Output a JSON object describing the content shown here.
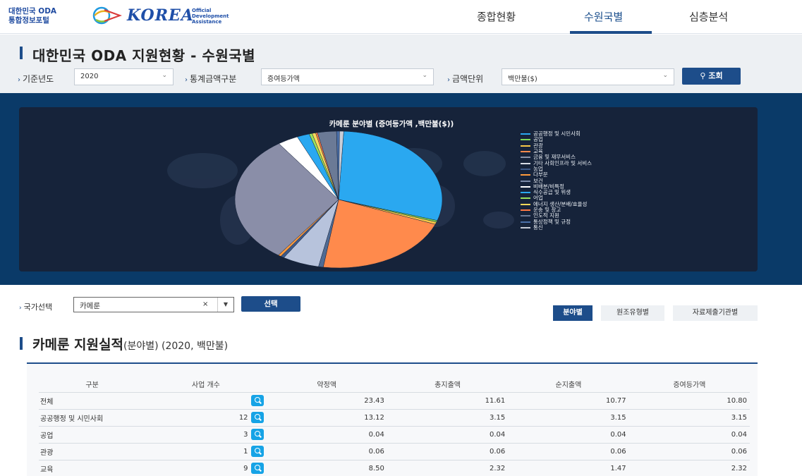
{
  "header": {
    "logo_korean_line1": "대한민국 ODA",
    "logo_korean_line2": "통합정보포털",
    "logo_brand": "KOREA",
    "logo_oda_line1": "Official",
    "logo_oda_line2": "Development",
    "logo_oda_line3": "Assistance",
    "nav": [
      {
        "label": "종합현황"
      },
      {
        "label": "수원국별"
      },
      {
        "label": "심층분석"
      }
    ]
  },
  "page_title": "대한민국 ODA 지원현황 - 수원국별",
  "filters": {
    "year_label": "기준년도",
    "year_value": "2020",
    "stat_label": "통계금액구분",
    "stat_value": "증여등가액",
    "unit_label": "금액단위",
    "unit_value": "백만불($)",
    "search_button": "조회"
  },
  "chart_data": {
    "type": "pie",
    "title": "카메룬 분야별 (증여등가액 ,백만불($))",
    "legend": [
      {
        "name": "공공행정 및 시민사회",
        "color": "#2aa8f0"
      },
      {
        "name": "공업",
        "color": "#7ed957"
      },
      {
        "name": "관광",
        "color": "#f7c948"
      },
      {
        "name": "교육",
        "color": "#ff8a4c"
      },
      {
        "name": "금융 및 재무서비스",
        "color": "#8a93a8"
      },
      {
        "name": "기타 사회인프라 및 서비스",
        "color": "#d7dce6"
      },
      {
        "name": "농업",
        "color": "#3d5a8a"
      },
      {
        "name": "다부문",
        "color": "#ff9a3c"
      },
      {
        "name": "보건",
        "color": "#7b8aa8"
      },
      {
        "name": "비배분/비특정",
        "color": "#ffffff"
      },
      {
        "name": "식수공급 및 위생",
        "color": "#2aa8f0"
      },
      {
        "name": "어업",
        "color": "#9be15d"
      },
      {
        "name": "에너지 생산/분배/효율성",
        "color": "#f7d85a"
      },
      {
        "name": "운송 및 창고",
        "color": "#ff7a45"
      },
      {
        "name": "인도적 지원",
        "color": "#6b7a96"
      },
      {
        "name": "통상정책 및 규정",
        "color": "#4a6fa8"
      },
      {
        "name": "통신",
        "color": "#c9ced9"
      }
    ],
    "slices": [
      {
        "name": "공공행정 및 시민사회",
        "value": 3.15,
        "color": "#2aa8f0"
      },
      {
        "name": "공업",
        "value": 0.04,
        "color": "#7ed957"
      },
      {
        "name": "관광",
        "value": 0.06,
        "color": "#f7c948"
      },
      {
        "name": "교육",
        "value": 2.32,
        "color": "#ff8a4c"
      },
      {
        "name": "금융 및 재무서비스",
        "value": 0.08,
        "color": "#4f6b94"
      },
      {
        "name": "기타 사회인프라 및 서비스",
        "value": 0.62,
        "color": "#b7c3dc"
      },
      {
        "name": "농업",
        "value": 0.06,
        "color": "#3d5a8a"
      },
      {
        "name": "다부문",
        "value": 0.05,
        "color": "#ff9a3c"
      },
      {
        "name": "보건",
        "value": 3.28,
        "color": "#8a8ea8"
      },
      {
        "name": "비배분/비특정",
        "value": 0.35,
        "color": "#ffffff"
      },
      {
        "name": "식수공급 및 위생",
        "value": 0.21,
        "color": "#2aa8f0"
      },
      {
        "name": "어업",
        "value": 0.05,
        "color": "#9be15d"
      },
      {
        "name": "에너지 생산/분배/효율성",
        "value": 0.06,
        "color": "#f7d85a"
      },
      {
        "name": "운송 및 창고",
        "value": 0.03,
        "color": "#ff7a45"
      },
      {
        "name": "인도적 지원",
        "value": 0.32,
        "color": "#6b7a96"
      },
      {
        "name": "통상정책 및 규정",
        "value": 0.05,
        "color": "#4a6fa8"
      },
      {
        "name": "통신",
        "value": 0.07,
        "color": "#c9ced9"
      }
    ]
  },
  "country": {
    "label": "국가선택",
    "value": "카메룬",
    "clear": "×",
    "dropdown": "▼",
    "select_button": "선택"
  },
  "tabs": [
    {
      "label": "분야별"
    },
    {
      "label": "원조유형별"
    },
    {
      "label": "자료제출기관별"
    }
  ],
  "result": {
    "title": "카메룬 지원실적",
    "subtitle": "(분야별) (2020, 백만불)",
    "columns": [
      "구분",
      "사업 개수",
      "약정액",
      "총지출액",
      "순지출액",
      "증여등가액"
    ],
    "rows": [
      {
        "name": "전체",
        "count": "",
        "commit": "23.43",
        "gross": "11.61",
        "net": "10.77",
        "grant": "10.80"
      },
      {
        "name": "공공행정 및 시민사회",
        "count": "12",
        "commit": "13.12",
        "gross": "3.15",
        "net": "3.15",
        "grant": "3.15"
      },
      {
        "name": "공업",
        "count": "3",
        "commit": "0.04",
        "gross": "0.04",
        "net": "0.04",
        "grant": "0.04"
      },
      {
        "name": "관광",
        "count": "1",
        "commit": "0.06",
        "gross": "0.06",
        "net": "0.06",
        "grant": "0.06"
      },
      {
        "name": "교육",
        "count": "9",
        "commit": "8.50",
        "gross": "2.32",
        "net": "1.47",
        "grant": "2.32"
      }
    ]
  }
}
